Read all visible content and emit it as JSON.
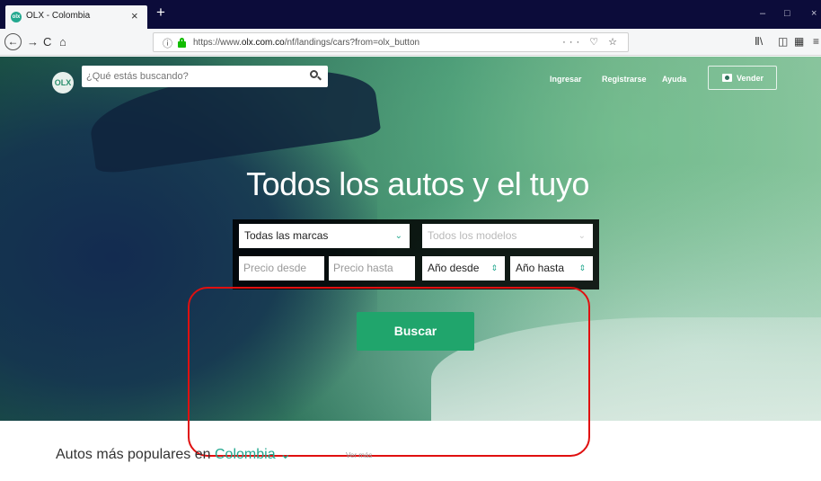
{
  "browser": {
    "tab_title": "OLX - Colombia",
    "tab_favicon": "olx",
    "tab_close": "×",
    "new_tab": "+",
    "window_minimize": "–",
    "window_restore": "□",
    "window_close": "×",
    "back": "←",
    "forward": "→",
    "reload": "C",
    "home": "⌂",
    "url_prefix": "https://www.",
    "url_domain": "olx.com.co",
    "url_path": "/nf/landings/cars?from=olx_button",
    "url_actions": "··· ♡ ☆"
  },
  "header": {
    "logo": "OLX",
    "search_placeholder": "¿Qué estás buscando?",
    "links": [
      "Ingresar",
      "Registrarse",
      "Ayuda"
    ],
    "sell_label": "Vender"
  },
  "hero": {
    "headline": "Todos los autos y el tuyo",
    "brand_select": "Todas las marcas",
    "model_select": "Todos los modelos",
    "price_from": "Precio desde",
    "price_to": "Precio hasta",
    "year_from": "Año desde",
    "year_to": "Año hasta",
    "search_button": "Buscar"
  },
  "popular": {
    "prefix": "Autos más populares en",
    "region": "Colombia",
    "see_more": "Ver más"
  },
  "colors": {
    "accent": "#20a56c",
    "brand_green": "#23a88f",
    "annotation": "#e01010"
  }
}
